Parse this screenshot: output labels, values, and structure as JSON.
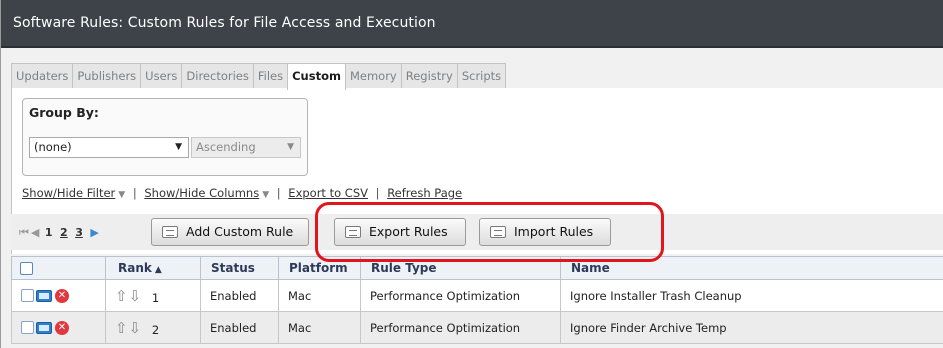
{
  "window": {
    "title": "Software Rules: Custom Rules for File Access and Execution"
  },
  "tabs": [
    {
      "label": "Updaters",
      "active": false
    },
    {
      "label": "Publishers",
      "active": false
    },
    {
      "label": "Users",
      "active": false
    },
    {
      "label": "Directories",
      "active": false
    },
    {
      "label": "Files",
      "active": false
    },
    {
      "label": "Custom",
      "active": true
    },
    {
      "label": "Memory",
      "active": false
    },
    {
      "label": "Registry",
      "active": false
    },
    {
      "label": "Scripts",
      "active": false
    }
  ],
  "group_by": {
    "label": "Group By:",
    "field_value": "(none)",
    "order_value": "Ascending"
  },
  "links": {
    "show_hide_filter": "Show/Hide Filter",
    "show_hide_columns": "Show/Hide Columns",
    "export_csv": "Export to CSV",
    "refresh_page": "Refresh Page"
  },
  "pager": {
    "current": "1",
    "pages": [
      "2",
      "3"
    ]
  },
  "buttons": {
    "add_custom_rule": "Add Custom Rule",
    "export_rules": "Export Rules",
    "import_rules": "Import Rules"
  },
  "table": {
    "headers": [
      "Rank",
      "Status",
      "Platform",
      "Rule Type",
      "Name"
    ],
    "sorted_column": "Rank",
    "sort_direction": "ascending",
    "rows": [
      {
        "rank": "1",
        "status": "Enabled",
        "platform": "Mac",
        "rule_type": "Performance Optimization",
        "name": "Ignore Installer Trash Cleanup"
      },
      {
        "rank": "2",
        "status": "Enabled",
        "platform": "Mac",
        "rule_type": "Performance Optimization",
        "name": "Ignore Finder Archive Temp"
      }
    ]
  },
  "colors": {
    "titlebar": "#3e4349",
    "annotation": "#e0161c",
    "link_blue": "#3a8ad3",
    "delete_red": "#e0383e"
  },
  "icons": [
    "checkbox-icon",
    "edit-icon",
    "delete-icon",
    "move-up-icon",
    "move-down-icon",
    "rules-icon"
  ]
}
